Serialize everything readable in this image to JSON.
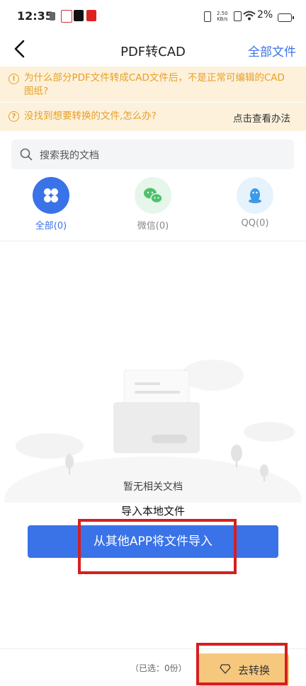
{
  "status_bar": {
    "time": "12:35",
    "net_speed_value": "2.50",
    "net_speed_unit": "KB/s",
    "battery": "2%"
  },
  "header": {
    "title": "PDF转CAD",
    "right_action": "全部文件"
  },
  "notices": [
    {
      "text_line1": "为什么部分PDF文件转成CAD文件后，不是正常可编辑的CAD",
      "text_line2": "图纸?"
    },
    {
      "text": "没找到想要转换的文件,怎么办?",
      "link": "点击查看办法"
    }
  ],
  "search": {
    "placeholder": "搜索我的文档"
  },
  "tabs": [
    {
      "label": "全部(0)",
      "active": true,
      "color": "#3a72e8"
    },
    {
      "label": "微信(0)",
      "active": false,
      "color": "#4fc16a"
    },
    {
      "label": "QQ(0)",
      "active": false,
      "color": "#3a9ae8"
    }
  ],
  "empty_state": {
    "message": "暂无相关文档",
    "import_title": "导入本地文件",
    "import_button": "从其他APP将文件导入"
  },
  "bottom_bar": {
    "selected_text": "（已选：0份）",
    "convert_button": "去转换"
  },
  "colors": {
    "accent": "#3a72e8",
    "notice_bg": "#fdf1dc",
    "notice_text": "#e7a024",
    "highlight": "#d51f1f"
  }
}
